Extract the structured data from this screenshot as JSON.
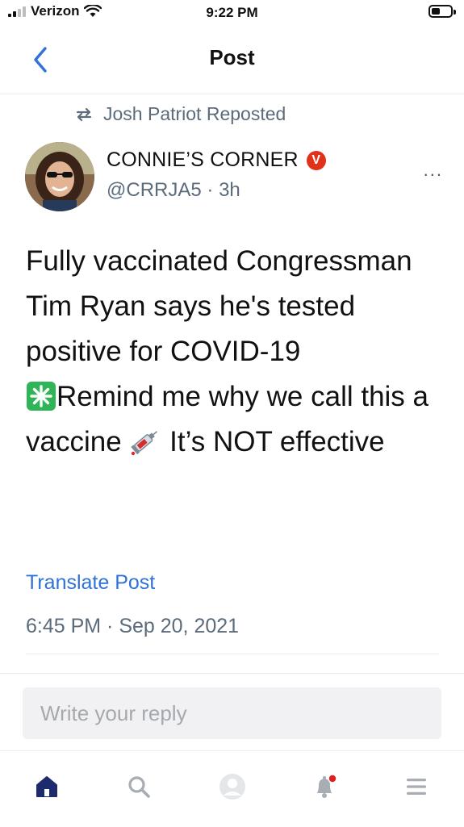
{
  "status_bar": {
    "carrier": "Verizon",
    "time": "9:22 PM"
  },
  "nav": {
    "title": "Post"
  },
  "repost": {
    "text": "Josh Patriot Reposted"
  },
  "post": {
    "author_name": "CONNIE’S CORNER",
    "badge_letter": "V",
    "handle": "@CRRJA5",
    "separator": "·",
    "age": "3h",
    "more": "...",
    "body_lines": [
      "Fully vaccinated Congressman Tim Ryan says he's tested positive for COVID-19"
    ],
    "body_second_line": "Remind me why we call this a vaccine",
    "body_tail": " It’s NOT effective",
    "translate_label": "Translate Post",
    "timestamp": "6:45 PM · Sep 20, 2021"
  },
  "reply": {
    "placeholder": "Write your reply"
  },
  "tabs": [
    {
      "name": "home",
      "icon": "home-icon",
      "active": true
    },
    {
      "name": "search",
      "icon": "search-icon"
    },
    {
      "name": "profile",
      "icon": "avatar-icon"
    },
    {
      "name": "notifications",
      "icon": "bell-icon",
      "has_dot": true
    },
    {
      "name": "menu",
      "icon": "menu-icon"
    }
  ],
  "colors": {
    "accent": "#2f73d9",
    "muted": "#5b6b7b",
    "badge": "#e0311b",
    "tab_active": "#1d2b6e",
    "tab_inactive": "#a8acb3",
    "notification_dot": "#e02020"
  }
}
